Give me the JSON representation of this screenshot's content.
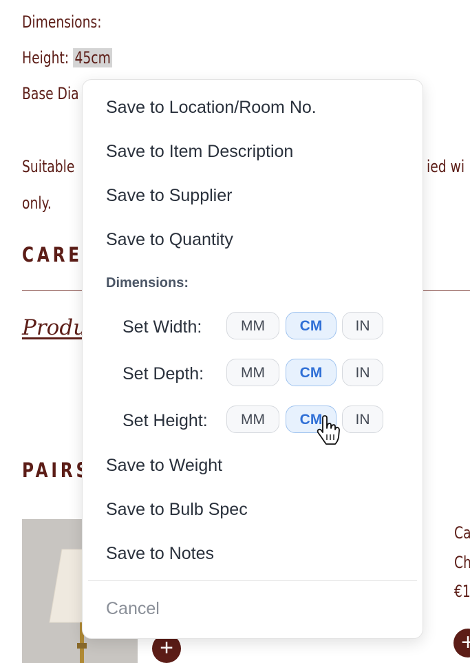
{
  "background": {
    "dimensions_label": "Dimensions:",
    "height_label": "Height:",
    "height_value": "45cm",
    "base_label": "Base Dia",
    "suitable_text": "Suitable",
    "supplied_text": "ied wi",
    "only_text": "only.",
    "care_heading": "CARE",
    "product_link": "Produc",
    "pairs_heading": "PAIRS",
    "right_col": [
      "Ca",
      "Ch",
      "€1"
    ],
    "add_symbol": "+"
  },
  "menu": {
    "items_top": [
      "Save to Location/Room No.",
      "Save to Item Description",
      "Save to Supplier",
      "Save to Quantity"
    ],
    "dimensions_label": "Dimensions:",
    "dimension_rows": [
      {
        "label": "Set Width:",
        "units": [
          "MM",
          "CM",
          "IN"
        ],
        "selected": "CM"
      },
      {
        "label": "Set Depth:",
        "units": [
          "MM",
          "CM",
          "IN"
        ],
        "selected": "CM"
      },
      {
        "label": "Set Height:",
        "units": [
          "MM",
          "CM",
          "IN"
        ],
        "selected": "CM"
      }
    ],
    "items_bottom": [
      "Save to Weight",
      "Save to Bulb Spec",
      "Save to Notes"
    ],
    "cancel_label": "Cancel"
  },
  "colors": {
    "brand": "#5c1d17",
    "selected_unit": "#2f6fd6",
    "selected_unit_bg": "#e7f1fd"
  }
}
